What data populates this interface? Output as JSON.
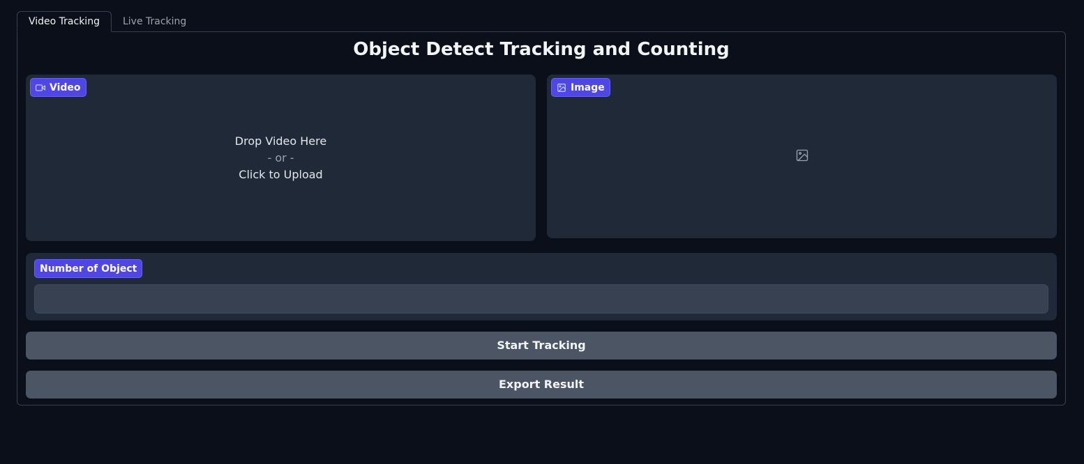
{
  "tabs": [
    {
      "label": "Video Tracking",
      "active": true
    },
    {
      "label": "Live Tracking",
      "active": false
    }
  ],
  "page": {
    "title": "Object Detect Tracking and Counting"
  },
  "video_input": {
    "label": "Video",
    "icon": "video-camera-icon",
    "drop_text": "Drop Video Here",
    "or_text": "- or -",
    "click_text": "Click to Upload"
  },
  "image_output": {
    "label": "Image",
    "icon": "image-icon",
    "placeholder_icon": "image-placeholder-icon"
  },
  "count_output": {
    "label": "Number of Object",
    "value": ""
  },
  "buttons": {
    "start_label": "Start Tracking",
    "export_label": "Export Result"
  },
  "colors": {
    "background": "#0b0f19",
    "block": "#1f2937",
    "accent": "#4f46e5",
    "button": "#4b5563"
  }
}
